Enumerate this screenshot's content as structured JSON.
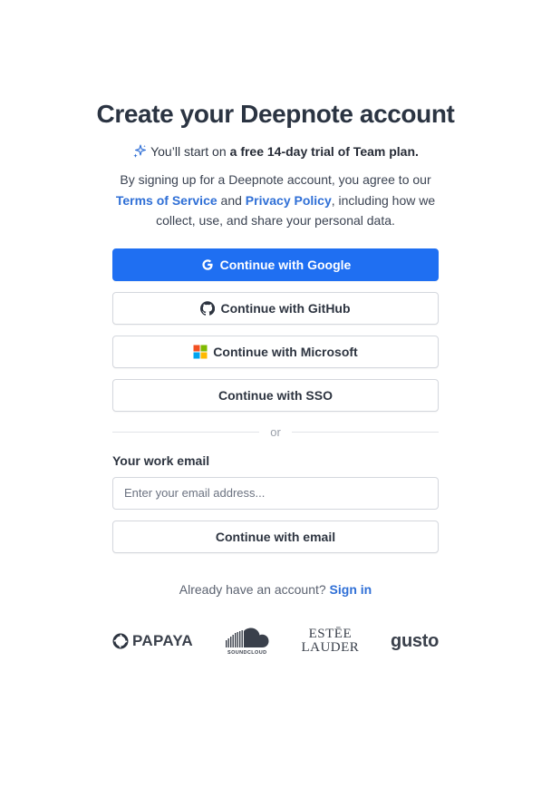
{
  "header": {
    "title": "Create your Deepnote account",
    "trial_prefix": "You’ll start on ",
    "trial_bold": "a free 14-day trial of Team plan."
  },
  "terms": {
    "prefix": "By signing up for a Deepnote account, you agree to our",
    "tos_link": "Terms of Service",
    "and": "and",
    "privacy_link": "Privacy Policy",
    "suffix": ", including how we collect, use, and share your personal data."
  },
  "auth_buttons": {
    "google": "Continue with Google",
    "github": "Continue with GitHub",
    "microsoft": "Continue with Microsoft",
    "sso": "Continue with SSO"
  },
  "divider": {
    "label": "or"
  },
  "email": {
    "label": "Your work email",
    "placeholder": "Enter your email address...",
    "value": "",
    "submit": "Continue with email"
  },
  "signin": {
    "prompt": "Already have an account?",
    "link": "Sign in"
  },
  "logos": {
    "papaya": "PAPAYA",
    "soundcloud": "SOUNDCLOUD",
    "estee_line1": "ESTĒE",
    "estee_line2": "LAUDER",
    "gusto": "gusto"
  },
  "colors": {
    "primary": "#1f6ff2",
    "link": "#2f6fd6",
    "title": "#2b3442",
    "border": "#d4d7dd"
  },
  "icons": [
    "sparkle-icon",
    "google-icon",
    "github-icon",
    "microsoft-icon",
    "papaya-logo",
    "soundcloud-logo"
  ]
}
